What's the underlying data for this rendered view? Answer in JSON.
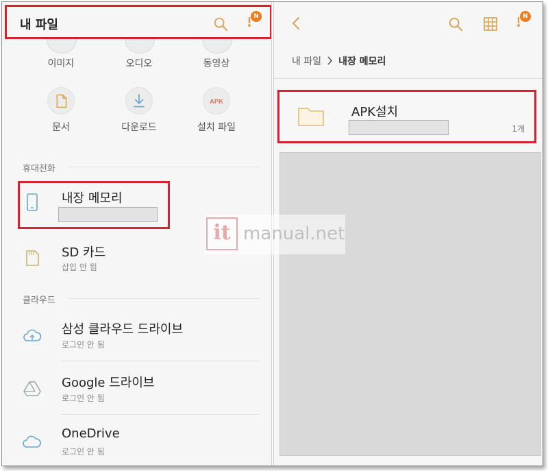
{
  "left_panel": {
    "title": "내 파일",
    "notification_badge": "N",
    "categories": [
      {
        "label": "이미지",
        "icon": "image-icon"
      },
      {
        "label": "오디오",
        "icon": "audio-icon"
      },
      {
        "label": "동영상",
        "icon": "video-icon"
      },
      {
        "label": "문서",
        "icon": "document-icon"
      },
      {
        "label": "다운로드",
        "icon": "download-icon"
      },
      {
        "label": "설치 파일",
        "icon": "apk-icon",
        "icon_text": "APK"
      }
    ],
    "sections": {
      "phone": "휴대전화",
      "cloud": "클라우드"
    },
    "storage": [
      {
        "name": "내장 메모리",
        "sub": "",
        "icon": "phone-icon"
      },
      {
        "name": "SD 카드",
        "sub": "삽입 안 됨",
        "icon": "sd-card-icon"
      }
    ],
    "cloud_items": [
      {
        "name": "삼성 클라우드 드라이브",
        "sub": "로그인 안 됨",
        "icon": "samsung-cloud-icon"
      },
      {
        "name": "Google 드라이브",
        "sub": "로그인 안 됨",
        "icon": "google-drive-icon"
      },
      {
        "name": "OneDrive",
        "sub": "로그인 안 됨",
        "icon": "onedrive-icon"
      }
    ]
  },
  "right_panel": {
    "notification_badge": "N",
    "breadcrumb": {
      "root": "내 파일",
      "current": "내장 메모리"
    },
    "folder": {
      "name": "APK설치",
      "count": "1개"
    }
  },
  "watermark": {
    "logo": "it",
    "text": "manual.net"
  },
  "colors": {
    "accent": "#f07b1c",
    "highlight": "#d9222a",
    "icon_orange": "#d9a24a"
  }
}
